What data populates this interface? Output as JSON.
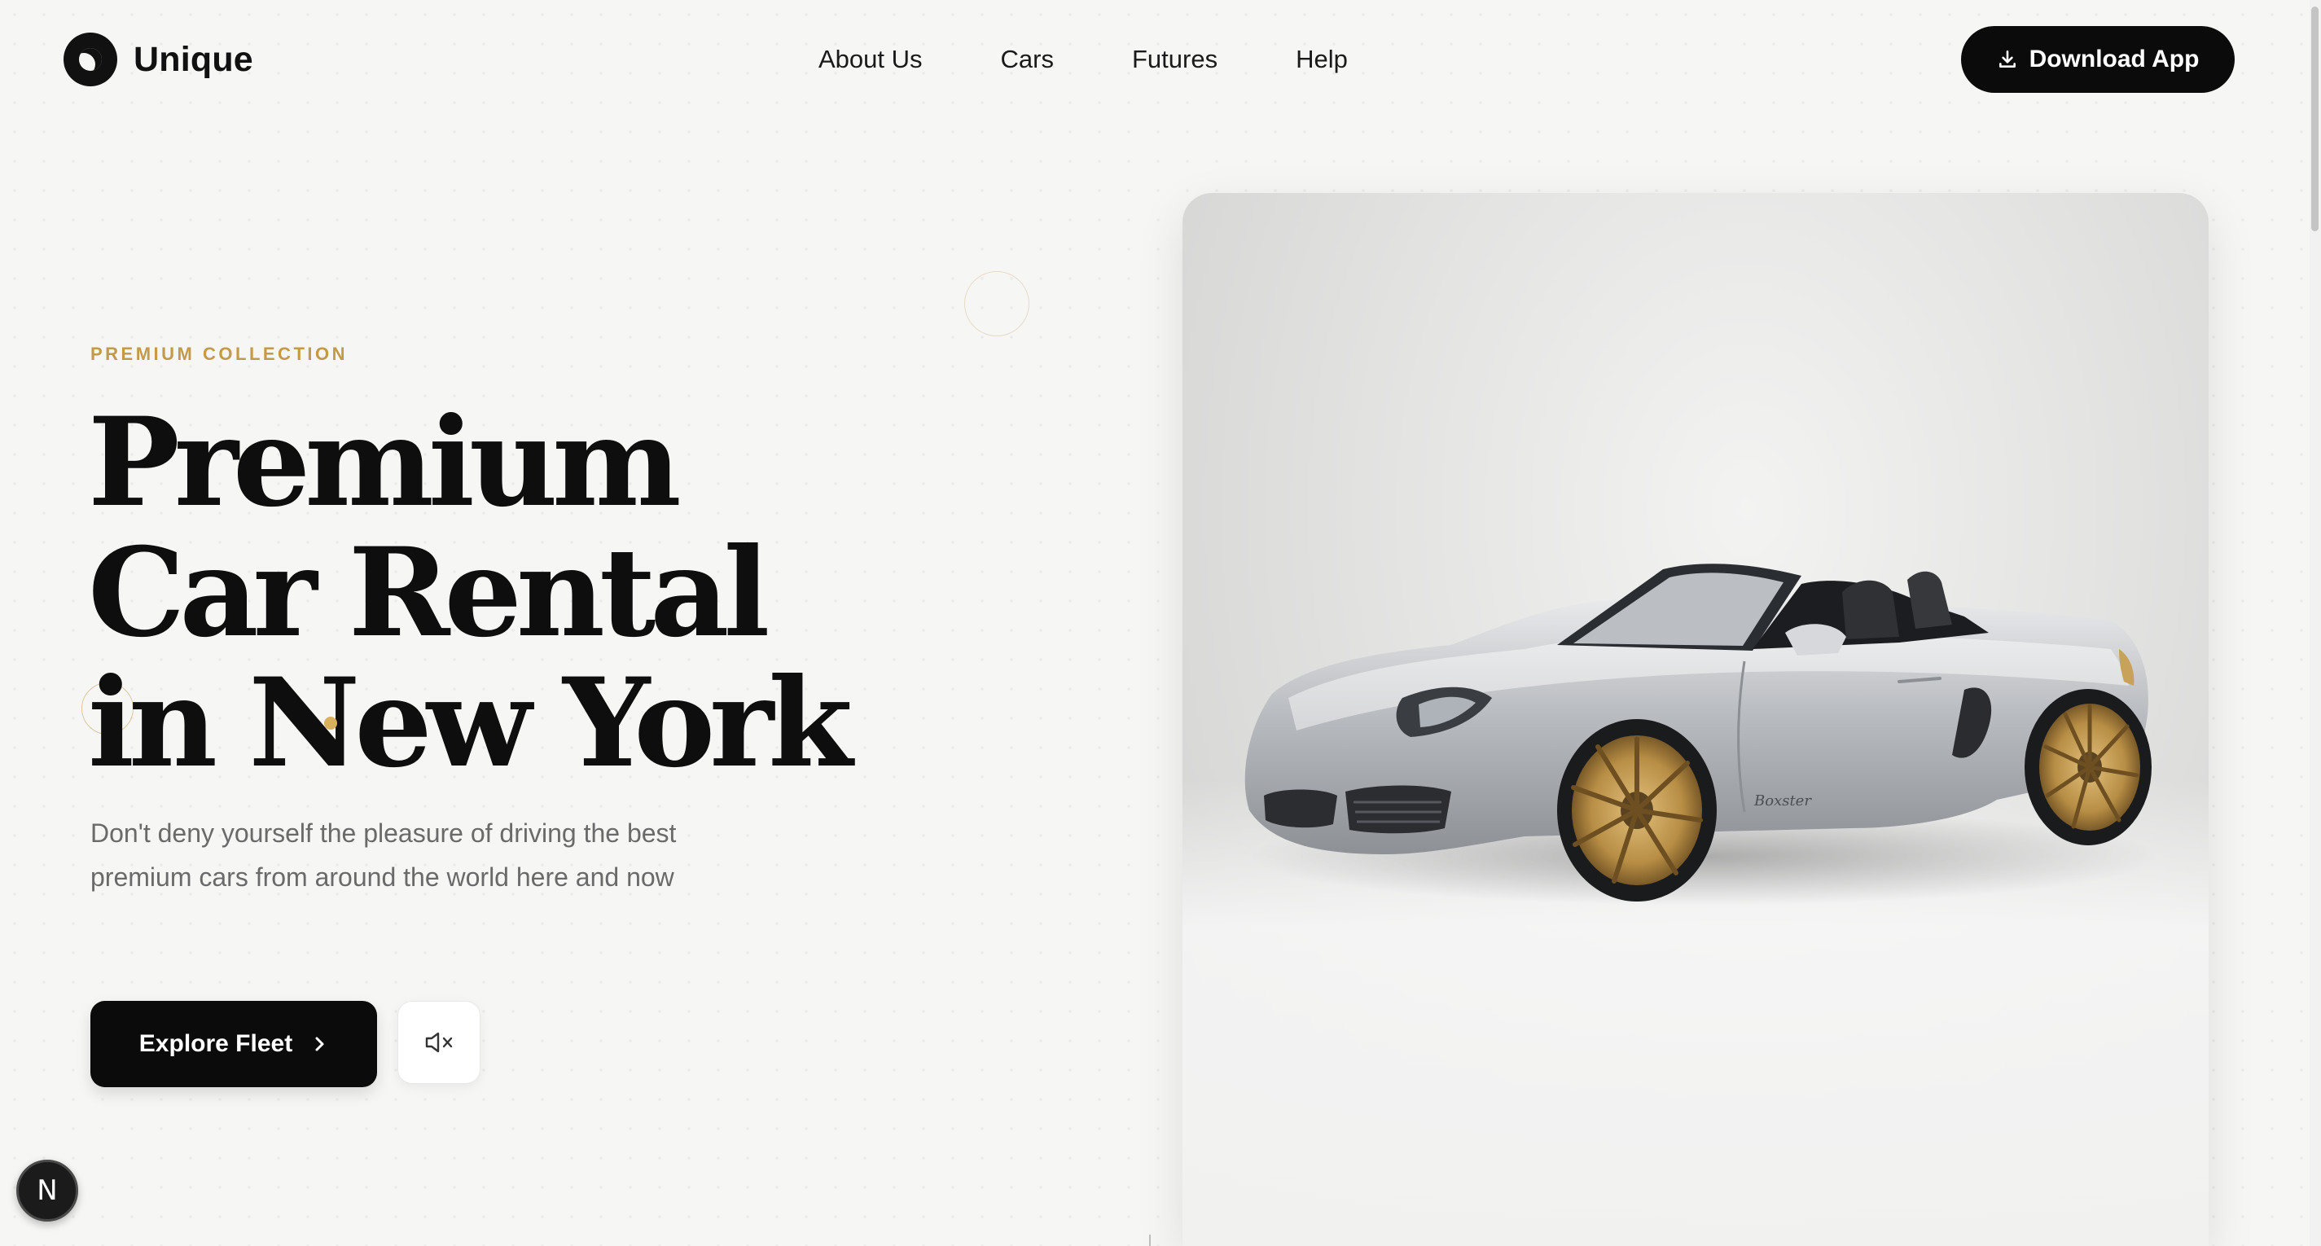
{
  "brand": {
    "name": "Unique",
    "logo_icon": "half-circle-logo-icon"
  },
  "nav": {
    "items": [
      {
        "label": "About Us"
      },
      {
        "label": "Cars"
      },
      {
        "label": "Futures"
      },
      {
        "label": "Help"
      }
    ]
  },
  "header": {
    "download_label": "Download App",
    "download_icon": "download-icon"
  },
  "hero": {
    "eyebrow": "PREMIUM COLLECTION",
    "headline": [
      "Premium",
      "Car Rental",
      "in New York"
    ],
    "subtitle": "Don't deny yourself the pleasure of driving the best premium cars from around the world here and now",
    "cta_label": "Explore Fleet",
    "cta_icon": "chevron-right-icon",
    "mute_icon": "speaker-muted-icon",
    "image_alt": "silver-convertible-sports-car",
    "car_badge": "Boxster"
  },
  "colors": {
    "accent_gold": "#c39a48",
    "primary_dark": "#0b0b0b",
    "background": "#f6f6f4",
    "muted_text": "#6a6a6a"
  },
  "dev_badge": {
    "label": "N"
  }
}
